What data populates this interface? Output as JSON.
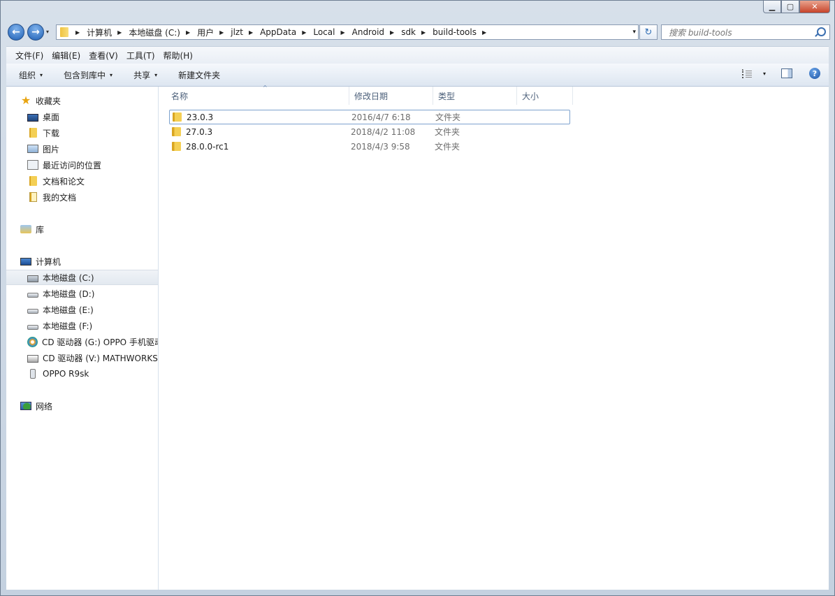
{
  "window": {
    "controls": {
      "minimize": "▁",
      "maximize": "▢",
      "close": "✕"
    }
  },
  "nav": {
    "back": "←",
    "forward": "→",
    "history": "▾"
  },
  "address": {
    "separator": "▶",
    "crumbs": [
      "计算机",
      "本地磁盘 (C:)",
      "用户",
      "jlzt",
      "AppData",
      "Local",
      "Android",
      "sdk",
      "build-tools"
    ],
    "dropdown": "▾",
    "refresh": "↻"
  },
  "search": {
    "placeholder": "搜索 build-tools"
  },
  "menubar": [
    "文件(F)",
    "编辑(E)",
    "查看(V)",
    "工具(T)",
    "帮助(H)"
  ],
  "toolbar": {
    "organize": "组织",
    "include_library": "包含到库中",
    "share": "共享",
    "new_folder": "新建文件夹",
    "caret": "▾",
    "help": "?"
  },
  "sidebar": {
    "favorites": {
      "label": "收藏夹",
      "items": [
        "桌面",
        "下载",
        "图片",
        "最近访问的位置",
        "文档和论文",
        "我的文档"
      ]
    },
    "libraries": {
      "label": "库"
    },
    "computer": {
      "label": "计算机",
      "items": [
        "本地磁盘 (C:)",
        "本地磁盘 (D:)",
        "本地磁盘 (E:)",
        "本地磁盘 (F:)",
        "CD 驱动器 (G:) OPPO 手机驱动",
        "CD 驱动器 (V:) MATHWORKS",
        "OPPO R9sk"
      ]
    },
    "network": {
      "label": "网络"
    }
  },
  "files": {
    "columns": {
      "name": "名称",
      "modified": "修改日期",
      "type": "类型",
      "size": "大小"
    },
    "sort_indicator": "^",
    "rows": [
      {
        "name": "23.0.3",
        "modified": "2016/4/7 6:18",
        "type": "文件夹",
        "size": ""
      },
      {
        "name": "27.0.3",
        "modified": "2018/4/2 11:08",
        "type": "文件夹",
        "size": ""
      },
      {
        "name": "28.0.0-rc1",
        "modified": "2018/4/3 9:58",
        "type": "文件夹",
        "size": ""
      }
    ]
  }
}
